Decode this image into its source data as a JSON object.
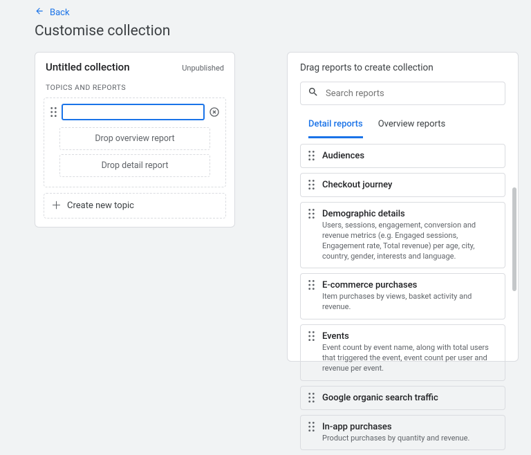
{
  "nav": {
    "back": "Back"
  },
  "page": {
    "title": "Customise collection"
  },
  "left": {
    "title": "Untitled collection",
    "status": "Unpublished",
    "section_label": "TOPICS AND REPORTS",
    "topic_input_value": "",
    "drop_overview": "Drop overview report",
    "drop_detail": "Drop detail report",
    "create_topic": "Create new topic"
  },
  "right": {
    "title": "Drag reports to create collection",
    "search_placeholder": "Search reports",
    "tabs": {
      "detail": "Detail reports",
      "overview": "Overview reports"
    },
    "reports": [
      {
        "title": "Audiences",
        "desc": ""
      },
      {
        "title": "Checkout journey",
        "desc": ""
      },
      {
        "title": "Demographic details",
        "desc": "Users, sessions, engagement, conversion and revenue metrics (e.g. Engaged sessions, Engagement rate, Total revenue) per age, city, country, gender, interests and language."
      },
      {
        "title": "E-commerce purchases",
        "desc": "Item purchases by views, basket activity and revenue."
      },
      {
        "title": "Events",
        "desc": "Event count by event name, along with total users that triggered the event, event count per user and revenue per event."
      },
      {
        "title": "Google organic search traffic",
        "desc": ""
      },
      {
        "title": "In-app purchases",
        "desc": "Product purchases by quantity and revenue."
      }
    ]
  }
}
